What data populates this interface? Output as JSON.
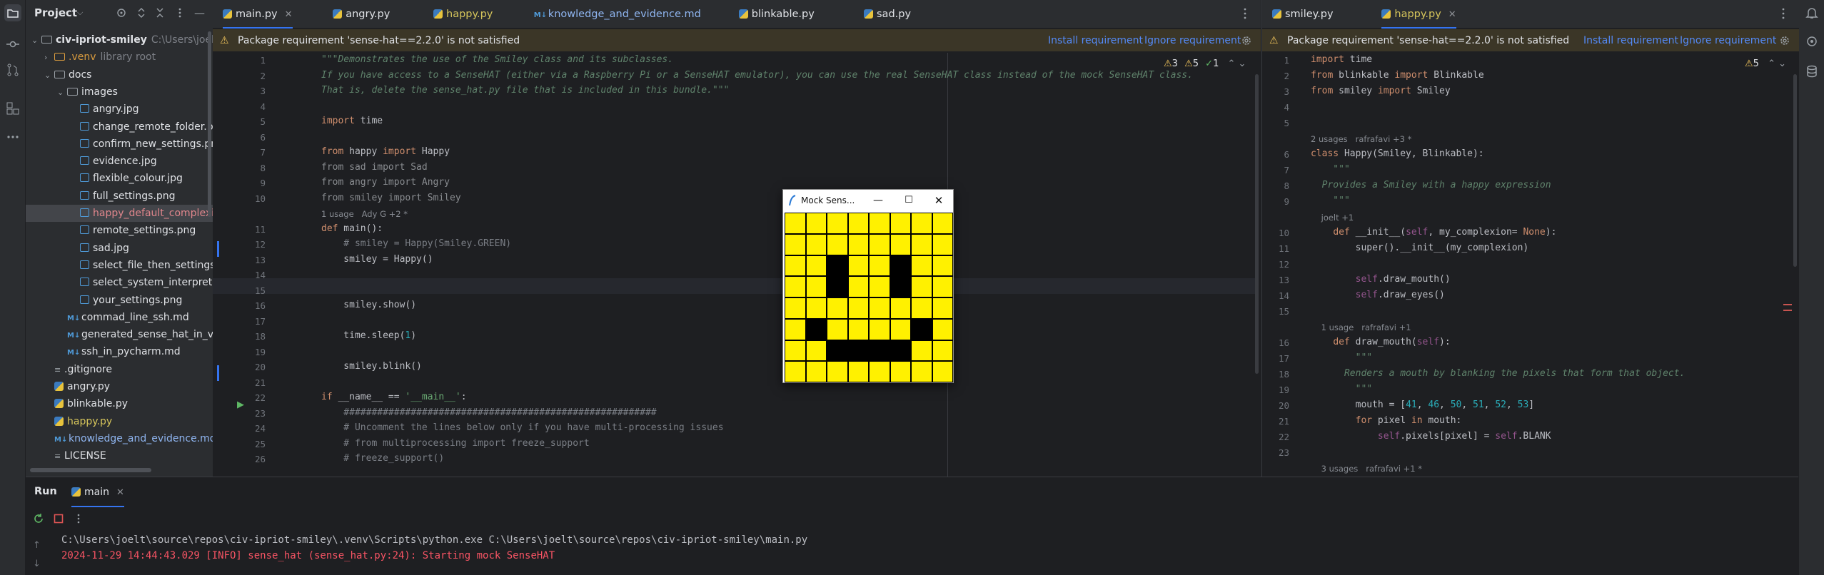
{
  "project_panel": {
    "title": "Project",
    "items": [
      {
        "label": "civ-ipriot-smiley",
        "hint": "C:\\Users\\joelt\\so",
        "kind": "folder-open",
        "depth": 0
      },
      {
        "label": ".venv",
        "hint": "library root",
        "kind": "folder-venv",
        "depth": 1
      },
      {
        "label": "docs",
        "kind": "folder-open",
        "depth": 1
      },
      {
        "label": "images",
        "kind": "folder-open",
        "depth": 2
      },
      {
        "label": "angry.jpg",
        "kind": "image",
        "depth": 3
      },
      {
        "label": "change_remote_folder.p",
        "kind": "image",
        "depth": 3
      },
      {
        "label": "confirm_new_settings.pn",
        "kind": "image",
        "depth": 3
      },
      {
        "label": "evidence.jpg",
        "kind": "image",
        "depth": 3
      },
      {
        "label": "flexible_colour.jpg",
        "kind": "image",
        "depth": 3
      },
      {
        "label": "full_settings.png",
        "kind": "image",
        "depth": 3
      },
      {
        "label": "happy_default_complexic",
        "kind": "image-red",
        "depth": 3,
        "selected": true
      },
      {
        "label": "remote_settings.png",
        "kind": "image",
        "depth": 3
      },
      {
        "label": "sad.jpg",
        "kind": "image",
        "depth": 3
      },
      {
        "label": "select_file_then_settings",
        "kind": "image",
        "depth": 3
      },
      {
        "label": "select_system_interprete",
        "kind": "image",
        "depth": 3
      },
      {
        "label": "your_settings.png",
        "kind": "image",
        "depth": 3
      },
      {
        "label": "commad_line_ssh.md",
        "kind": "md",
        "depth": 2
      },
      {
        "label": "generated_sense_hat_in_virt",
        "kind": "md",
        "depth": 2
      },
      {
        "label": "ssh_in_pycharm.md",
        "kind": "md",
        "depth": 2
      },
      {
        "label": ".gitignore",
        "kind": "file",
        "depth": 1
      },
      {
        "label": "angry.py",
        "kind": "py",
        "depth": 1
      },
      {
        "label": "blinkable.py",
        "kind": "py",
        "depth": 1
      },
      {
        "label": "happy.py",
        "kind": "py-yellow",
        "depth": 1
      },
      {
        "label": "knowledge_and_evidence.md",
        "kind": "md-blue",
        "depth": 1
      },
      {
        "label": "LICENSE",
        "kind": "file",
        "depth": 1
      },
      {
        "label": "main.py",
        "kind": "py-yellow",
        "depth": 1
      }
    ]
  },
  "left_tabs": [
    {
      "label": "main.py",
      "kind": "py",
      "active": true,
      "closable": true
    },
    {
      "label": "angry.py",
      "kind": "py"
    },
    {
      "label": "happy.py",
      "kind": "py",
      "color": "#d6c55b"
    },
    {
      "label": "knowledge_and_evidence.md",
      "kind": "md",
      "color": "#8fb5f0"
    },
    {
      "label": "blinkable.py",
      "kind": "py"
    },
    {
      "label": "sad.py",
      "kind": "py"
    }
  ],
  "right_tabs": [
    {
      "label": "smiley.py",
      "kind": "py"
    },
    {
      "label": "happy.py",
      "kind": "py",
      "active": true,
      "closable": true,
      "color": "#d6c55b"
    }
  ],
  "banner": {
    "message": "Package requirement 'sense-hat==2.2.0' is not satisfied",
    "install": "Install requirement",
    "ignore": "Ignore requirement"
  },
  "left_inspections": {
    "warnings": "3",
    "weak": "5",
    "ok": "1"
  },
  "right_inspections": {
    "weak": "5"
  },
  "left_code": [
    {
      "n": "1",
      "t": "\"\"\"Demonstrates the use of the Smiley class and its subclasses.",
      "c": "doc"
    },
    {
      "n": "2",
      "t": "If you have access to a SenseHAT (either via a Raspberry Pi or a SenseHAT emulator), you can use the real SenseHAT class instead of the mock SenseHAT class.",
      "c": "doc"
    },
    {
      "n": "3",
      "t": "That is, delete the sense_hat.py file that is included in this bundle.\"\"\"",
      "c": "doc"
    },
    {
      "n": "4",
      "t": ""
    },
    {
      "n": "5",
      "t": "import time"
    },
    {
      "n": "6",
      "t": ""
    },
    {
      "n": "7",
      "t": "from happy import Happy"
    },
    {
      "n": "8",
      "t": "from sad import Sad",
      "c": "dim"
    },
    {
      "n": "9",
      "t": "from angry import Angry",
      "c": "dim"
    },
    {
      "n": "10",
      "t": "from smiley import Smiley",
      "c": "dim"
    },
    {
      "hint": "1 usage   Ady G +2 *"
    },
    {
      "n": "11",
      "t": "def main():"
    },
    {
      "n": "12",
      "t": "    # smiley = Happy(Smiley.GREEN)",
      "c": "cm"
    },
    {
      "n": "13",
      "t": "    smiley = Happy()"
    },
    {
      "n": "14",
      "t": ""
    },
    {
      "n": "15",
      "t": ""
    },
    {
      "n": "16",
      "t": "    smiley.show()"
    },
    {
      "n": "17",
      "t": ""
    },
    {
      "n": "18",
      "t": "    time.sleep(1)"
    },
    {
      "n": "19",
      "t": ""
    },
    {
      "n": "20",
      "t": "    smiley.blink()"
    },
    {
      "n": "21",
      "t": ""
    },
    {
      "n": "22",
      "t": "if __name__ == '__main__':"
    },
    {
      "n": "23",
      "t": "    ########################################################",
      "c": "cm"
    },
    {
      "n": "24",
      "t": "    # Uncomment the lines below only if you have multi-processing issues",
      "c": "cm"
    },
    {
      "n": "25",
      "t": "    # from multiprocessing import freeze_support",
      "c": "cm"
    },
    {
      "n": "26",
      "t": "    # freeze_support()",
      "c": "cm"
    }
  ],
  "right_code": [
    {
      "n": "1",
      "t": "import time"
    },
    {
      "n": "2",
      "t": "from blinkable import Blinkable"
    },
    {
      "n": "3",
      "t": "from smiley import Smiley"
    },
    {
      "n": "4",
      "t": ""
    },
    {
      "n": "5",
      "t": ""
    },
    {
      "hint": "2 usages   rafrafavi +3 *"
    },
    {
      "n": "6",
      "t": "class Happy(Smiley, Blinkable):"
    },
    {
      "n": "7",
      "t": "    \"\"\"",
      "c": "doc"
    },
    {
      "n": "8",
      "t": "  Provides a Smiley with a happy expression",
      "c": "doc"
    },
    {
      "n": "9",
      "t": "    \"\"\"",
      "c": "doc"
    },
    {
      "hint": "    joelt +1"
    },
    {
      "n": "10",
      "t": "    def __init__(self, my_complexion= None):"
    },
    {
      "n": "11",
      "t": "        super().__init__(my_complexion)"
    },
    {
      "n": "12",
      "t": ""
    },
    {
      "n": "13",
      "t": "        self.draw_mouth()"
    },
    {
      "n": "14",
      "t": "        self.draw_eyes()"
    },
    {
      "n": "15",
      "t": ""
    },
    {
      "hint": "    1 usage   rafrafavi +1"
    },
    {
      "n": "16",
      "t": "    def draw_mouth(self):"
    },
    {
      "n": "17",
      "t": "        \"\"\"",
      "c": "doc"
    },
    {
      "n": "18",
      "t": "      Renders a mouth by blanking the pixels that form that object.",
      "c": "doc"
    },
    {
      "n": "19",
      "t": "        \"\"\"",
      "c": "doc"
    },
    {
      "n": "20",
      "t": "        mouth = [41, 46, 50, 51, 52, 53]"
    },
    {
      "n": "21",
      "t": "        for pixel in mouth:"
    },
    {
      "n": "22",
      "t": "            self.pixels[pixel] = self.BLANK"
    },
    {
      "n": "23",
      "t": ""
    },
    {
      "hint": "    3 usages   rafrafavi +1 *"
    }
  ],
  "run_panel": {
    "title": "Run",
    "tab": "main",
    "lines": [
      {
        "text": "C:\\Users\\joelt\\source\\repos\\civ-ipriot-smiley\\.venv\\Scripts\\python.exe C:\\Users\\joelt\\source\\repos\\civ-ipriot-smiley\\main.py",
        "color": "#bcbec4"
      },
      {
        "text": "2024-11-29 14:44:43.029 [INFO] sense_hat (sense_hat.py:24): Starting mock SenseHAT",
        "color": "#f75464"
      }
    ]
  },
  "mock_window": {
    "title": "Mock Sens...",
    "pixels": [
      [
        1,
        1,
        1,
        1,
        1,
        1,
        1,
        1
      ],
      [
        1,
        1,
        1,
        1,
        1,
        1,
        1,
        1
      ],
      [
        1,
        1,
        0,
        1,
        1,
        0,
        1,
        1
      ],
      [
        1,
        1,
        0,
        1,
        1,
        0,
        1,
        1
      ],
      [
        1,
        1,
        1,
        1,
        1,
        1,
        1,
        1
      ],
      [
        1,
        0,
        1,
        1,
        1,
        1,
        0,
        1
      ],
      [
        1,
        1,
        0,
        0,
        0,
        0,
        1,
        1
      ],
      [
        1,
        1,
        1,
        1,
        1,
        1,
        1,
        1
      ]
    ],
    "on_color": "#fff100",
    "off_color": "#000000"
  }
}
